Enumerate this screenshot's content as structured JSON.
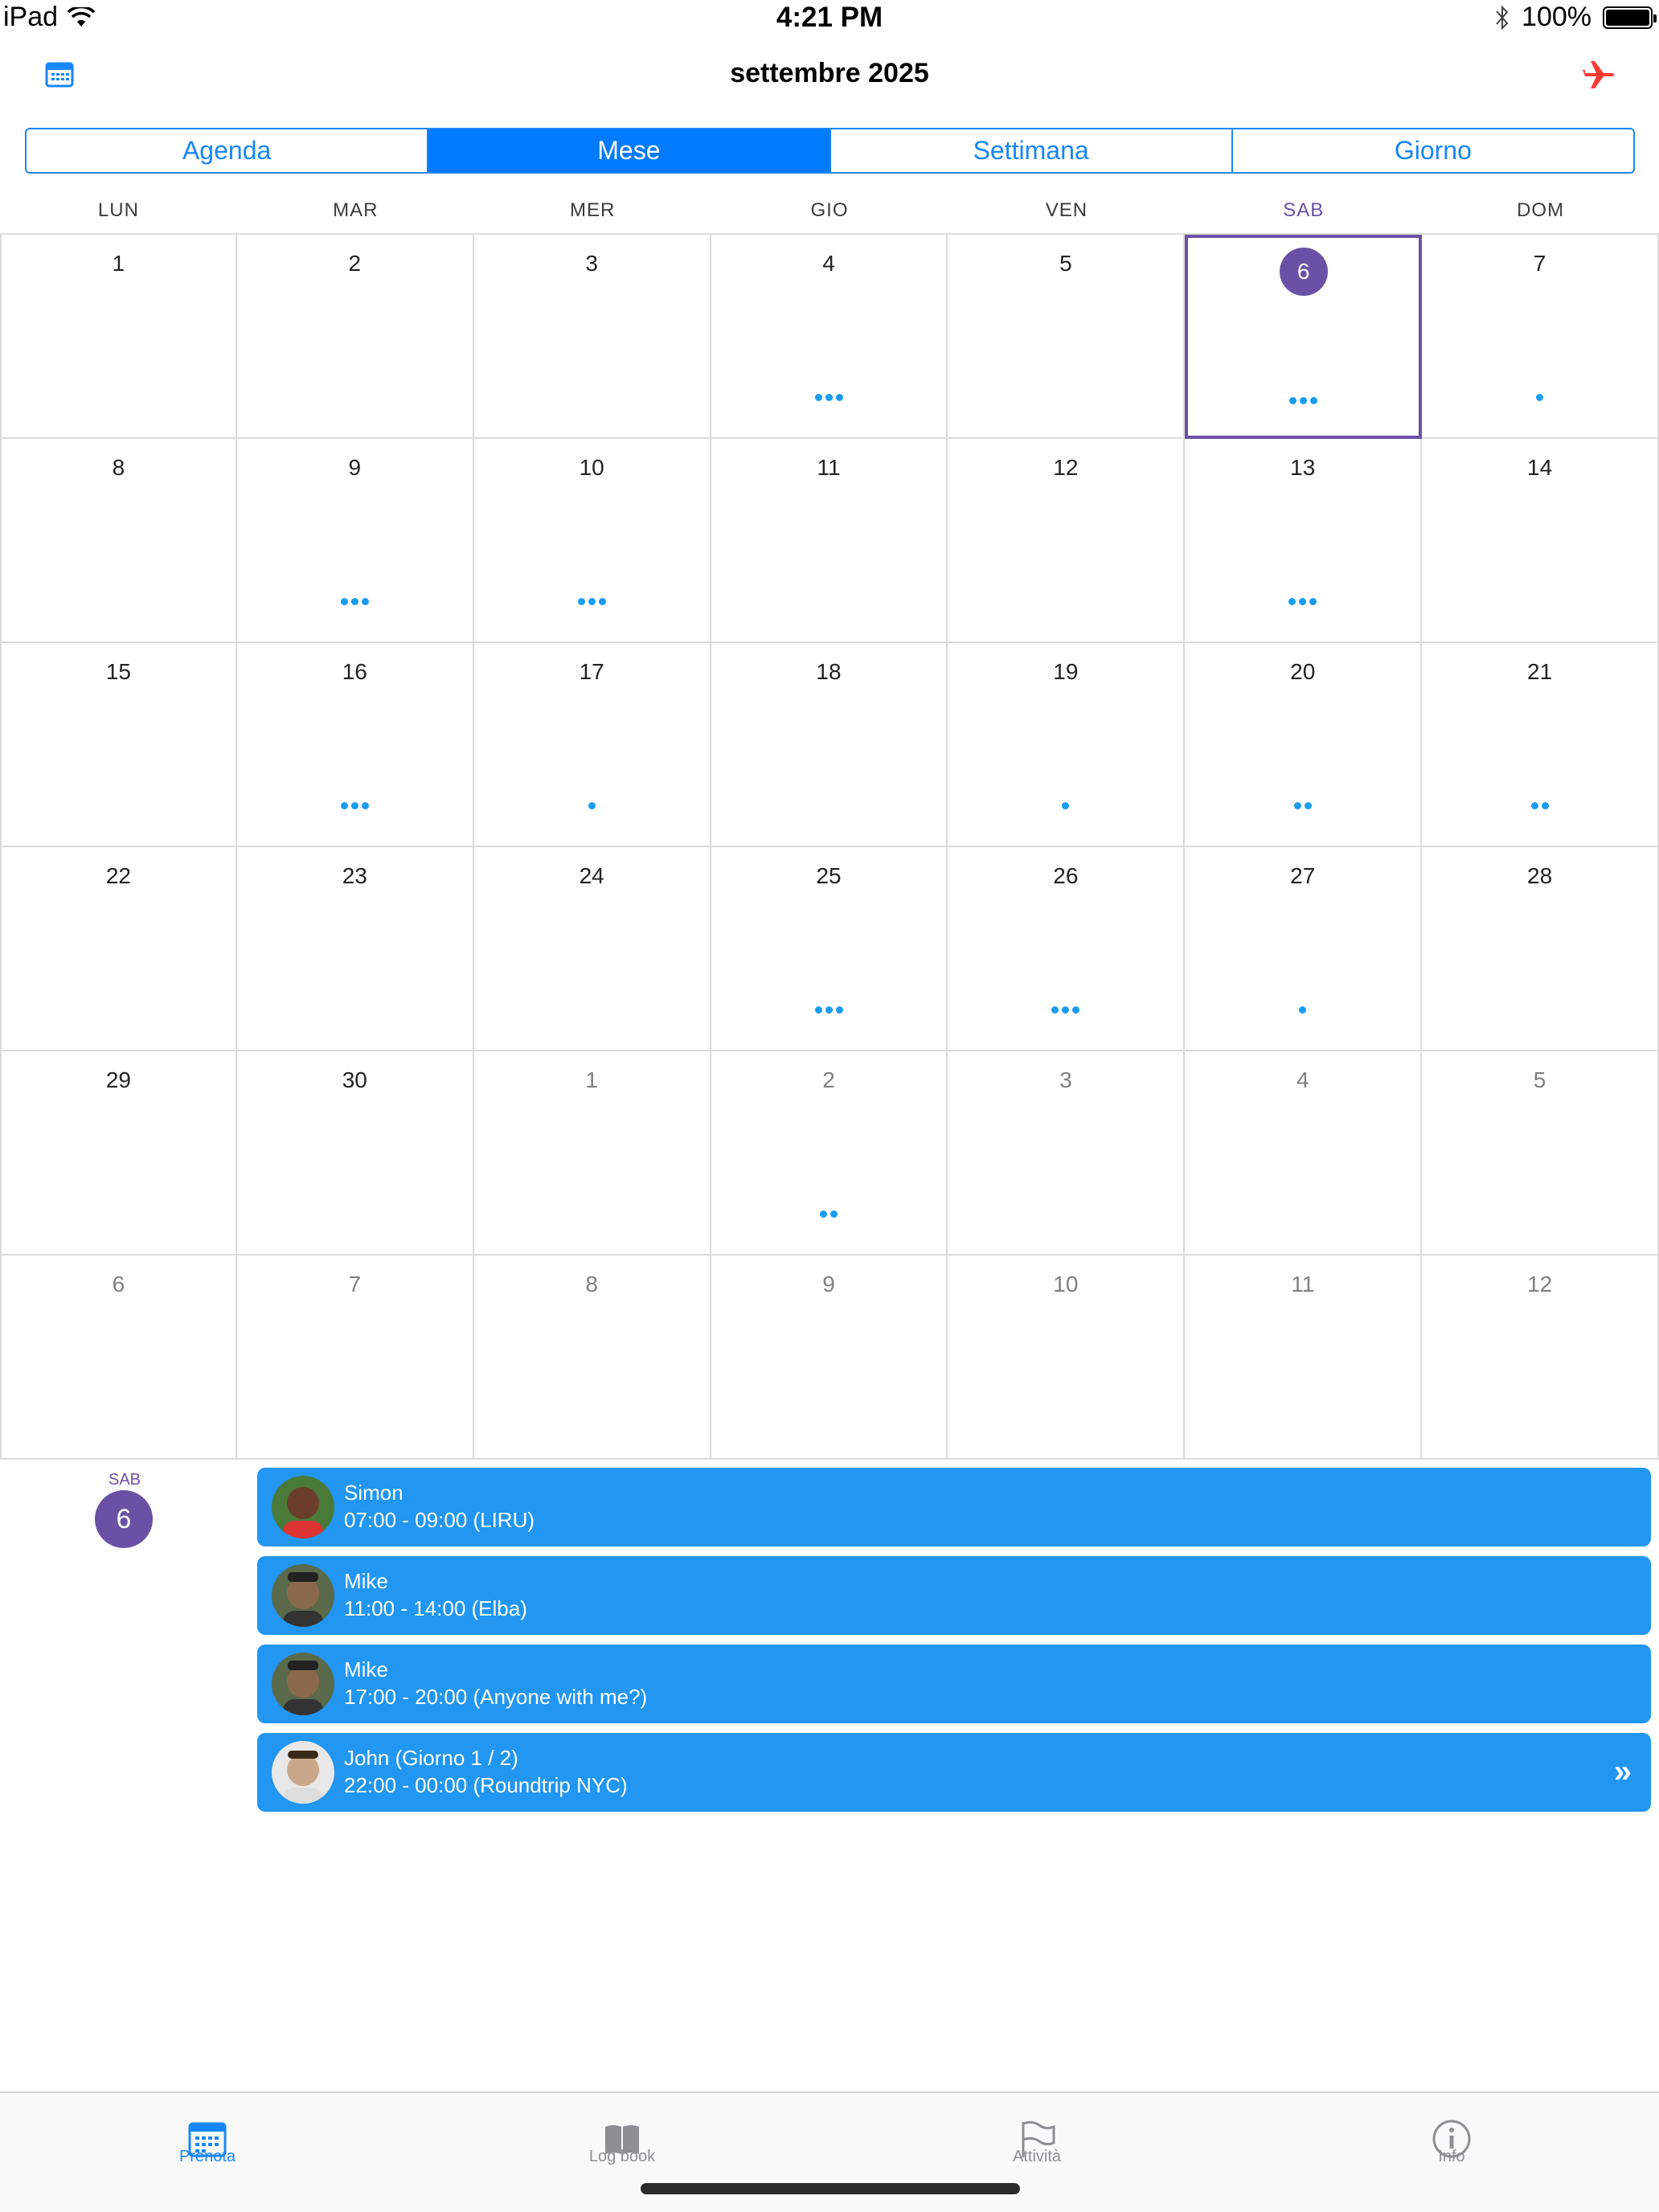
{
  "status": {
    "device": "iPad",
    "time": "4:21 PM",
    "battery": "100%"
  },
  "nav": {
    "title": "settembre 2025",
    "left_icon": "calendar-icon",
    "right_icon": "airplane-icon"
  },
  "segments": [
    {
      "label": "Agenda",
      "active": false
    },
    {
      "label": "Mese",
      "active": true
    },
    {
      "label": "Settimana",
      "active": false
    },
    {
      "label": "Giorno",
      "active": false
    }
  ],
  "weekdays": [
    "LUN",
    "MAR",
    "MER",
    "GIO",
    "VEN",
    "SAB",
    "DOM"
  ],
  "calendar": {
    "selected_day": "6",
    "weeks": [
      [
        {
          "d": "1",
          "dots": 0
        },
        {
          "d": "2",
          "dots": 0
        },
        {
          "d": "3",
          "dots": 0
        },
        {
          "d": "4",
          "dots": 3
        },
        {
          "d": "5",
          "dots": 0
        },
        {
          "d": "6",
          "dots": 3,
          "selected": true
        },
        {
          "d": "7",
          "dots": 1
        }
      ],
      [
        {
          "d": "8",
          "dots": 0
        },
        {
          "d": "9",
          "dots": 3
        },
        {
          "d": "10",
          "dots": 3
        },
        {
          "d": "11",
          "dots": 0
        },
        {
          "d": "12",
          "dots": 0
        },
        {
          "d": "13",
          "dots": 3
        },
        {
          "d": "14",
          "dots": 0
        }
      ],
      [
        {
          "d": "15",
          "dots": 0
        },
        {
          "d": "16",
          "dots": 3
        },
        {
          "d": "17",
          "dots": 1
        },
        {
          "d": "18",
          "dots": 0
        },
        {
          "d": "19",
          "dots": 1
        },
        {
          "d": "20",
          "dots": 2
        },
        {
          "d": "21",
          "dots": 2
        }
      ],
      [
        {
          "d": "22",
          "dots": 0
        },
        {
          "d": "23",
          "dots": 0
        },
        {
          "d": "24",
          "dots": 0
        },
        {
          "d": "25",
          "dots": 3
        },
        {
          "d": "26",
          "dots": 3
        },
        {
          "d": "27",
          "dots": 1
        },
        {
          "d": "28",
          "dots": 0
        }
      ],
      [
        {
          "d": "29",
          "dots": 0
        },
        {
          "d": "30",
          "dots": 0
        },
        {
          "d": "1",
          "dots": 0,
          "other": true
        },
        {
          "d": "2",
          "dots": 2,
          "other": true
        },
        {
          "d": "3",
          "dots": 0,
          "other": true
        },
        {
          "d": "4",
          "dots": 0,
          "other": true
        },
        {
          "d": "5",
          "dots": 0,
          "other": true
        }
      ],
      [
        {
          "d": "6",
          "dots": 0,
          "other": true
        },
        {
          "d": "7",
          "dots": 0,
          "other": true
        },
        {
          "d": "8",
          "dots": 0,
          "other": true
        },
        {
          "d": "9",
          "dots": 0,
          "other": true
        },
        {
          "d": "10",
          "dots": 0,
          "other": true
        },
        {
          "d": "11",
          "dots": 0,
          "other": true
        },
        {
          "d": "12",
          "dots": 0,
          "other": true
        }
      ]
    ]
  },
  "day_panel": {
    "weekday": "SAB",
    "day": "6"
  },
  "events": [
    {
      "name": "Simon",
      "time": "07:00 - 09:00 (LIRU)",
      "avatar_color": "#6b3e2a",
      "more": ""
    },
    {
      "name": "Mike",
      "time": "11:00 - 14:00 (Elba)",
      "avatar_color": "#8a6a4a",
      "more": ""
    },
    {
      "name": "Mike",
      "time": "17:00 - 20:00 (Anyone with me?)",
      "avatar_color": "#8a6a4a",
      "more": ""
    },
    {
      "name": "John (Giorno 1 / 2)",
      "time": "22:00 - 00:00 (Roundtrip NYC)",
      "avatar_color": "#c9a88a",
      "more": "»"
    }
  ],
  "tabs": [
    {
      "label": "Prenota",
      "icon": "calendar-icon",
      "active": true
    },
    {
      "label": "Log book",
      "icon": "book-icon",
      "active": false
    },
    {
      "label": "Attività",
      "icon": "flag-icon",
      "active": false
    },
    {
      "label": "Info",
      "icon": "info-icon",
      "active": false
    }
  ],
  "colors": {
    "accent": "#007aff",
    "selected": "#6a51a6",
    "event": "#2196f3",
    "dot": "#1a9cf0",
    "airplane": "#ff3b30"
  }
}
